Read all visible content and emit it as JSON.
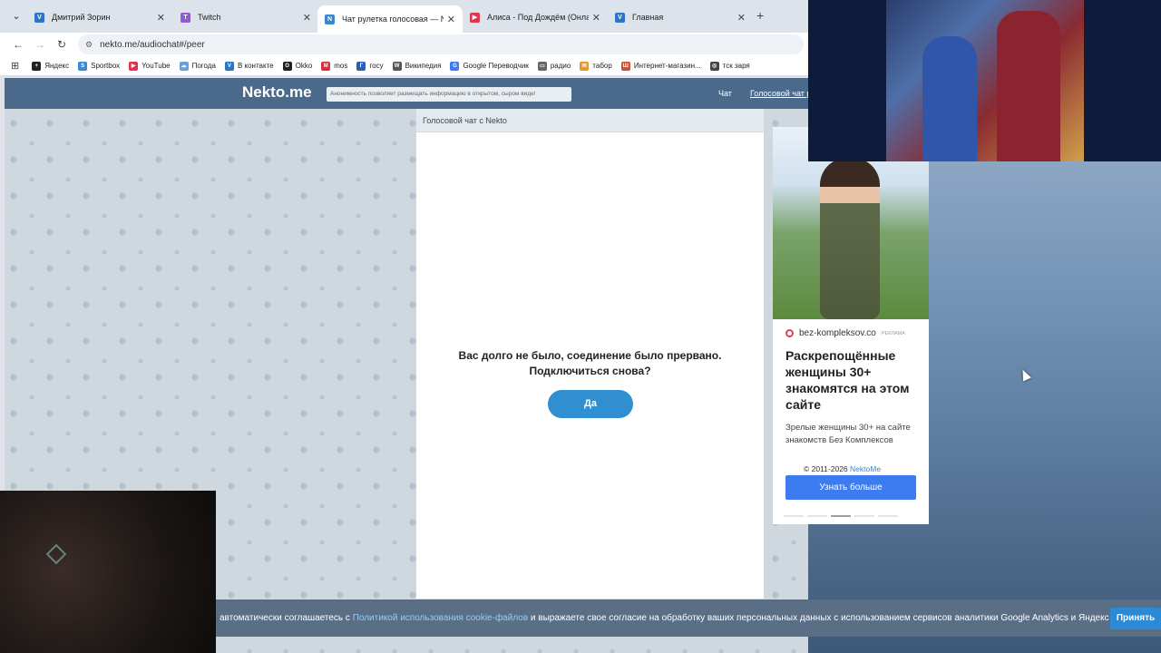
{
  "browser": {
    "tabs": [
      {
        "title": "Дмитрий Зорин",
        "icon": "vk-icon",
        "color": "#2a74c9",
        "glyph": "VK"
      },
      {
        "title": "Twitch",
        "icon": "twitch-icon",
        "color": "#8f5bd8",
        "glyph": "T"
      },
      {
        "title": "Чат рулетка голосовая — Nekto",
        "icon": "nekto-icon",
        "color": "#3b86c9",
        "glyph": "N"
      },
      {
        "title": "Алиса - Под Дождём (Онлайн",
        "icon": "youtube-icon",
        "color": "#e0334d",
        "glyph": "▶"
      },
      {
        "title": "Главная",
        "icon": "vk-icon",
        "color": "#2a74c9",
        "glyph": "VK"
      }
    ],
    "new_tab_label": "+",
    "url": "nekto.me/audiochat#/peer",
    "bookmarks": [
      {
        "label": "Яндекс",
        "icon": "yandex-icon",
        "color": "#222"
      },
      {
        "label": "Sportbox",
        "icon": "sportbox-icon",
        "color": "#3b8ad6"
      },
      {
        "label": "YouTube",
        "icon": "youtube-icon",
        "color": "#e0334d"
      },
      {
        "label": "Погода",
        "icon": "weather-icon",
        "color": "#6aa0d8"
      },
      {
        "label": "В контакте",
        "icon": "vk-icon",
        "color": "#2a74c9"
      },
      {
        "label": "Okko",
        "icon": "okko-icon",
        "color": "#222"
      },
      {
        "label": "mos",
        "icon": "mos-icon",
        "color": "#d2313e"
      },
      {
        "label": "госу",
        "icon": "gosuslugi-icon",
        "color": "#2f5fb5"
      },
      {
        "label": "Википедия",
        "icon": "wikipedia-icon",
        "color": "#555"
      },
      {
        "label": "Google Переводчик",
        "icon": "translate-icon",
        "color": "#3d7bf0"
      },
      {
        "label": "радио",
        "icon": "folder-icon",
        "color": "#666"
      },
      {
        "label": "табор",
        "icon": "mail-icon",
        "color": "#e8962e"
      },
      {
        "label": "Интернет-магазин...",
        "icon": "shop-icon",
        "color": "#c8553a"
      },
      {
        "label": "тск заря",
        "icon": "globe-icon",
        "color": "#444"
      }
    ]
  },
  "site": {
    "logo": "Nekto.me",
    "slogan": "Анонимность позволяет размещать информацию в открытом, сыром виде!",
    "nav_chat": "Чат",
    "nav_voice": "Голосовой чат р",
    "chat_header": "Голосовой чат с Nekto",
    "message_line1": "Вас долго не было, соединение было прервано.",
    "message_line2": "Подключиться снова?",
    "yes_button": "Да",
    "copyright": "© 2011-2026",
    "copyright_link": "NektoMe"
  },
  "ad": {
    "domain": "bez-kompleksov.co",
    "tag": "РЕКЛАМА",
    "title": "Раскрепощённые женщины 30+ знакомятся на этом сайте",
    "text": "Зрелые женщины 30+ на сайте знакомств Без Комплексов",
    "button": "Узнать больше"
  },
  "cookie": {
    "text_before": "автоматически соглашаетесь с",
    "link": "Политикой использования cookie-файлов",
    "text_after": "и выражаете свое согласие на обработку ваших персональных данных с использованием сервисов аналитики Google Analytics и Яндекс Метрика.",
    "accept_button": "Принять"
  }
}
